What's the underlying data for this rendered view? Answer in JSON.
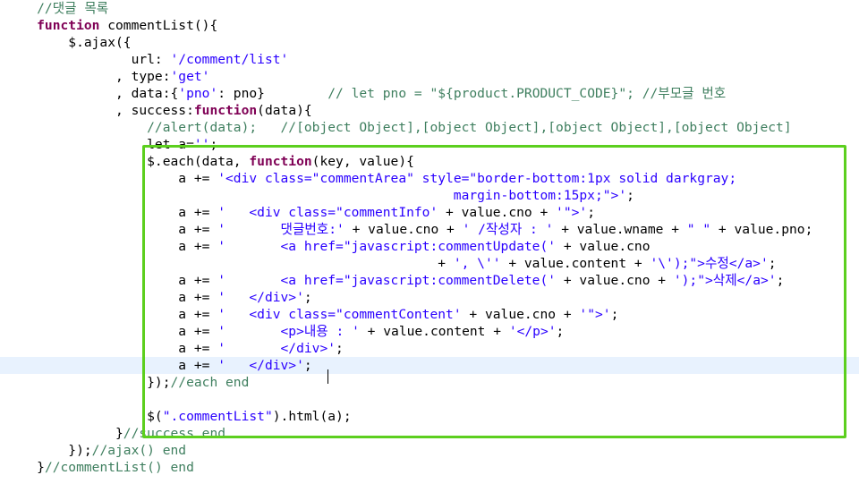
{
  "lines": [
    {
      "tokens": [
        {
          "t": "    //댓글 목록",
          "c": "comment"
        }
      ]
    },
    {
      "tokens": [
        {
          "t": "    function",
          "c": "kw"
        },
        {
          "t": " commentList(){",
          "c": "plain"
        }
      ]
    },
    {
      "tokens": [
        {
          "t": "        $.ajax({",
          "c": "plain"
        }
      ]
    },
    {
      "tokens": [
        {
          "t": "                url: ",
          "c": "plain"
        },
        {
          "t": "'/comment/list'",
          "c": "str"
        }
      ]
    },
    {
      "tokens": [
        {
          "t": "              , type:",
          "c": "plain"
        },
        {
          "t": "'get'",
          "c": "str"
        }
      ]
    },
    {
      "tokens": [
        {
          "t": "              , data:{",
          "c": "plain"
        },
        {
          "t": "'pno'",
          "c": "str"
        },
        {
          "t": ": pno}        ",
          "c": "plain"
        },
        {
          "t": "// let pno = \"${product.PRODUCT_CODE}\"; //부모글 번호",
          "c": "comment"
        }
      ]
    },
    {
      "tokens": [
        {
          "t": "              , success:",
          "c": "plain"
        },
        {
          "t": "function",
          "c": "kw"
        },
        {
          "t": "(data){",
          "c": "plain"
        }
      ]
    },
    {
      "tokens": [
        {
          "t": "                  //alert(data);   //[object Object],[object Object],[object Object],[object Object]",
          "c": "comment"
        }
      ]
    },
    {
      "tokens": [
        {
          "t": "                  let a=",
          "c": "plain"
        },
        {
          "t": "''",
          "c": "str"
        },
        {
          "t": ";",
          "c": "plain"
        }
      ]
    },
    {
      "tokens": [
        {
          "t": "                  $.each(data, ",
          "c": "plain"
        },
        {
          "t": "function",
          "c": "kw"
        },
        {
          "t": "(key, value){",
          "c": "plain"
        }
      ]
    },
    {
      "tokens": [
        {
          "t": "                      a += ",
          "c": "plain"
        },
        {
          "t": "'<div class=\"commentArea\" style=\"border-bottom:1px solid darkgray;",
          "c": "str"
        }
      ]
    },
    {
      "tokens": [
        {
          "t": "                                                         margin-bottom:15px;\">'",
          "c": "str"
        },
        {
          "t": ";",
          "c": "plain"
        }
      ]
    },
    {
      "tokens": [
        {
          "t": "                      a += ",
          "c": "plain"
        },
        {
          "t": "'   <div class=\"commentInfo'",
          "c": "str"
        },
        {
          "t": " + value.cno + ",
          "c": "plain"
        },
        {
          "t": "'\">'",
          "c": "str"
        },
        {
          "t": ";",
          "c": "plain"
        }
      ]
    },
    {
      "tokens": [
        {
          "t": "                      a += ",
          "c": "plain"
        },
        {
          "t": "'       댓글번호:'",
          "c": "str"
        },
        {
          "t": " + value.cno + ",
          "c": "plain"
        },
        {
          "t": "' /작성자 : '",
          "c": "str"
        },
        {
          "t": " + value.wname + ",
          "c": "plain"
        },
        {
          "t": "\" \"",
          "c": "str"
        },
        {
          "t": " + value.pno;",
          "c": "plain"
        }
      ]
    },
    {
      "tokens": [
        {
          "t": "                      a += ",
          "c": "plain"
        },
        {
          "t": "'       <a href=\"javascript:commentUpdate('",
          "c": "str"
        },
        {
          "t": " + value.cno",
          "c": "plain"
        }
      ]
    },
    {
      "tokens": [
        {
          "t": "                                                       + ",
          "c": "plain"
        },
        {
          "t": "', \\''",
          "c": "str"
        },
        {
          "t": " + value.content + ",
          "c": "plain"
        },
        {
          "t": "'\\');\">수정</a>'",
          "c": "str"
        },
        {
          "t": ";",
          "c": "plain"
        }
      ]
    },
    {
      "tokens": [
        {
          "t": "                      a += ",
          "c": "plain"
        },
        {
          "t": "'       <a href=\"javascript:commentDelete('",
          "c": "str"
        },
        {
          "t": " + value.cno + ",
          "c": "plain"
        },
        {
          "t": "');\">삭제</a>'",
          "c": "str"
        },
        {
          "t": ";",
          "c": "plain"
        }
      ]
    },
    {
      "tokens": [
        {
          "t": "                      a += ",
          "c": "plain"
        },
        {
          "t": "'   </div>'",
          "c": "str"
        },
        {
          "t": ";",
          "c": "plain"
        }
      ]
    },
    {
      "tokens": [
        {
          "t": "                      a += ",
          "c": "plain"
        },
        {
          "t": "'   <div class=\"commentContent'",
          "c": "str"
        },
        {
          "t": " + value.cno + ",
          "c": "plain"
        },
        {
          "t": "'\">'",
          "c": "str"
        },
        {
          "t": ";",
          "c": "plain"
        }
      ]
    },
    {
      "tokens": [
        {
          "t": "                      a += ",
          "c": "plain"
        },
        {
          "t": "'       <p>내용 : '",
          "c": "str"
        },
        {
          "t": " + value.content + ",
          "c": "plain"
        },
        {
          "t": "'</p>'",
          "c": "str"
        },
        {
          "t": ";",
          "c": "plain"
        }
      ]
    },
    {
      "tokens": [
        {
          "t": "                      a += ",
          "c": "plain"
        },
        {
          "t": "'       </div>'",
          "c": "str"
        },
        {
          "t": ";",
          "c": "plain"
        }
      ]
    },
    {
      "tokens": [
        {
          "t": "                      a += ",
          "c": "plain"
        },
        {
          "t": "'   </div>'",
          "c": "str"
        },
        {
          "t": ";",
          "c": "plain"
        }
      ]
    },
    {
      "tokens": [
        {
          "t": "                  });",
          "c": "plain"
        },
        {
          "t": "//each end",
          "c": "comment"
        }
      ]
    },
    {
      "tokens": [
        {
          "t": "",
          "c": "plain"
        }
      ]
    },
    {
      "tokens": [
        {
          "t": "                  $(",
          "c": "plain"
        },
        {
          "t": "\".commentList\"",
          "c": "str"
        },
        {
          "t": ").html(a);",
          "c": "plain"
        }
      ]
    },
    {
      "tokens": [
        {
          "t": "              }",
          "c": "plain"
        },
        {
          "t": "//success end",
          "c": "comment"
        }
      ]
    },
    {
      "tokens": [
        {
          "t": "        });",
          "c": "plain"
        },
        {
          "t": "//ajax() end",
          "c": "comment"
        }
      ]
    },
    {
      "tokens": [
        {
          "t": "    }",
          "c": "plain"
        },
        {
          "t": "//commentList() end",
          "c": "comment"
        }
      ]
    }
  ],
  "current_line": 22,
  "highlight_color": "#5ccf1e",
  "colors": {
    "keyword": "#7f0055",
    "string": "#2a00ff",
    "comment": "#3f7f5f",
    "current_line_bg": "#e8f2fe"
  }
}
